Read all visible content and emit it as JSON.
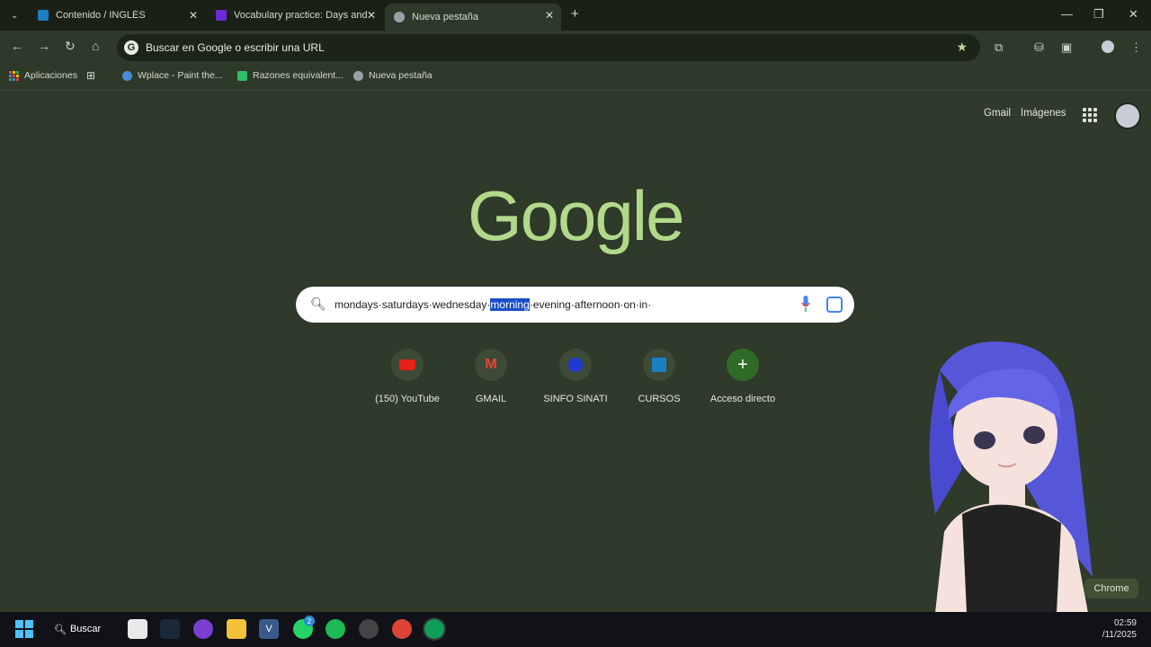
{
  "tabs": [
    {
      "title": "Contenido / INGLÉS",
      "color": "#1c7fc4"
    },
    {
      "title": "Vocabulary practice: Days and t",
      "color": "#6a2bd8"
    },
    {
      "title": "Nueva pestaña",
      "color": "#9aa0a6"
    }
  ],
  "omnibox": {
    "text": "Buscar en Google o escribir una URL"
  },
  "bookmarks": [
    {
      "label": "Aplicaciones"
    },
    {
      "label": "Wplace - Paint the..."
    },
    {
      "label": "Razones equivalent..."
    },
    {
      "label": "Nueva pestaña"
    }
  ],
  "header": {
    "gmail": "Gmail",
    "images": "Imágenes"
  },
  "logo": "Google",
  "search": {
    "before": "mondays·saturdays·wednesday·",
    "selected": "morning",
    "after": "·evening·afternoon·on·in·"
  },
  "shortcuts": [
    {
      "label": "(150) YouTube"
    },
    {
      "label": "GMAIL"
    },
    {
      "label": "SINFO SINATI"
    },
    {
      "label": "CURSOS"
    },
    {
      "label": "Acceso directo"
    }
  ],
  "customize_chip": "Chrome",
  "taskbar": {
    "search_label": "Buscar",
    "badge": "2",
    "time": "02:59",
    "date": "/11/2025"
  }
}
